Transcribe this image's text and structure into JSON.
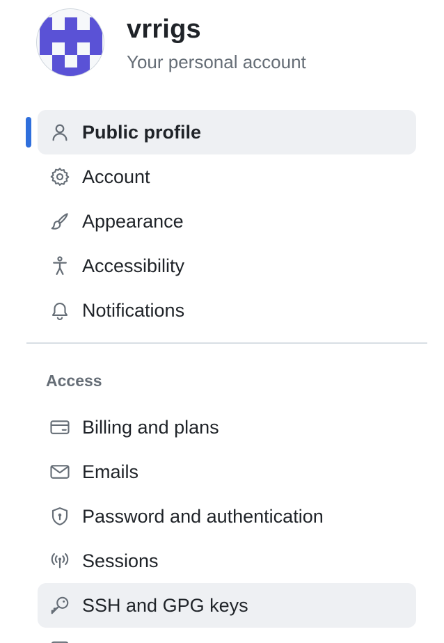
{
  "account": {
    "username": "vrrigs",
    "subtitle": "Your personal account"
  },
  "colors": {
    "accent": "#2f6fdc",
    "avatar": "#5a52d6",
    "active_bg": "#eef0f3"
  },
  "nav_primary": [
    {
      "label": "Public profile",
      "icon": "person-icon",
      "active": true
    },
    {
      "label": "Account",
      "icon": "gear-icon"
    },
    {
      "label": "Appearance",
      "icon": "paintbrush-icon"
    },
    {
      "label": "Accessibility",
      "icon": "accessibility-icon"
    },
    {
      "label": "Notifications",
      "icon": "bell-icon"
    }
  ],
  "access_section": {
    "heading": "Access",
    "items": [
      {
        "label": "Billing and plans",
        "icon": "credit-card-icon"
      },
      {
        "label": "Emails",
        "icon": "mail-icon"
      },
      {
        "label": "Password and authentication",
        "icon": "shield-lock-icon"
      },
      {
        "label": "Sessions",
        "icon": "broadcast-icon"
      },
      {
        "label": "SSH and GPG keys",
        "icon": "key-icon",
        "hovered": true
      }
    ]
  }
}
